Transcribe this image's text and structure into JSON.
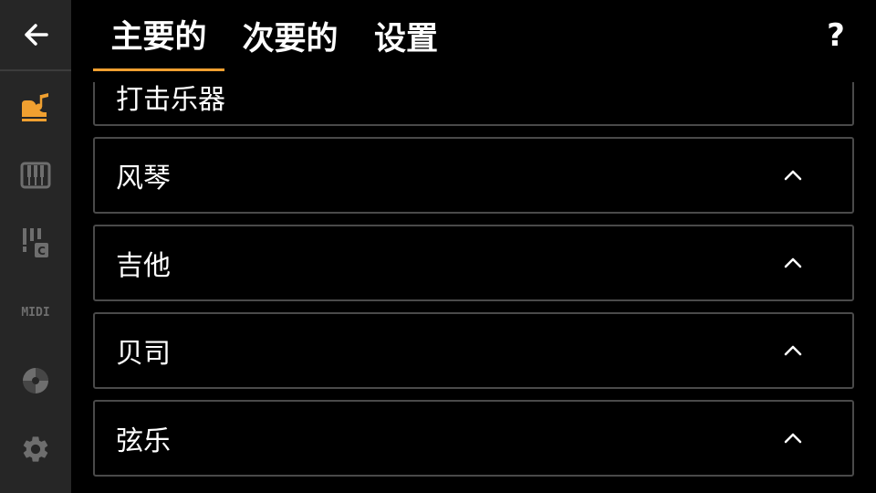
{
  "tabs": [
    {
      "label": "主要的",
      "active": true
    },
    {
      "label": "次要的",
      "active": false
    },
    {
      "label": "设置",
      "active": false
    }
  ],
  "help_label": "?",
  "sidebar": {
    "icons": [
      "back-arrow-icon",
      "instrument-note-icon",
      "piano-keys-icon",
      "tuner-c-icon",
      "midi-icon",
      "disc-icon",
      "gear-icon"
    ],
    "midi_text": "MIDI"
  },
  "categories": [
    {
      "label": "打击乐器"
    },
    {
      "label": "风琴"
    },
    {
      "label": "吉他"
    },
    {
      "label": "贝司"
    },
    {
      "label": "弦乐"
    }
  ],
  "colors": {
    "accent": "#f0a030",
    "sidebar_bg": "#262626",
    "icon_gray": "#6e6e6e",
    "border": "#4a4a4a"
  }
}
